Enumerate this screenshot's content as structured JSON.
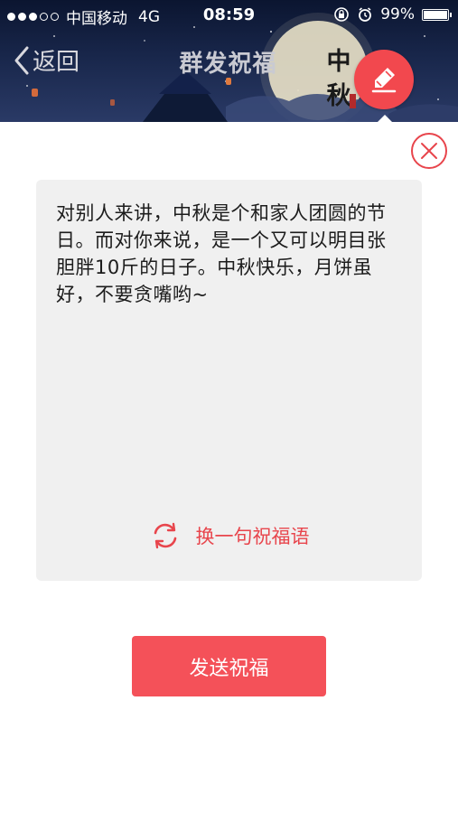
{
  "status_bar": {
    "carrier": "中国移动",
    "network": "4G",
    "time": "08:59",
    "battery_percent": "99%",
    "battery_level": 0.99,
    "signal_bars_filled": 3,
    "signal_bars_total": 5,
    "icons": [
      "orientation-lock-icon",
      "alarm-icon",
      "battery-icon"
    ]
  },
  "header": {
    "back_label": "返回",
    "title": "群发祝福",
    "calligraphy": "中秋",
    "edit_icon": "pen-edit-icon"
  },
  "message": {
    "text": "对别人来讲，中秋是个和家人团圆的节日。而对你来说，是一个又可以明目张胆胖10斤的日子。中秋快乐，月饼虽好，不要贪嘴哟~",
    "swap_label": "换一句祝福语",
    "swap_icon": "refresh-icon",
    "close_icon": "close-circle-icon"
  },
  "send_button": {
    "label": "发送祝福"
  },
  "colors": {
    "accent": "#f2484e",
    "card_bg": "#f0f0f0",
    "banner_dark": "#0b1530"
  }
}
